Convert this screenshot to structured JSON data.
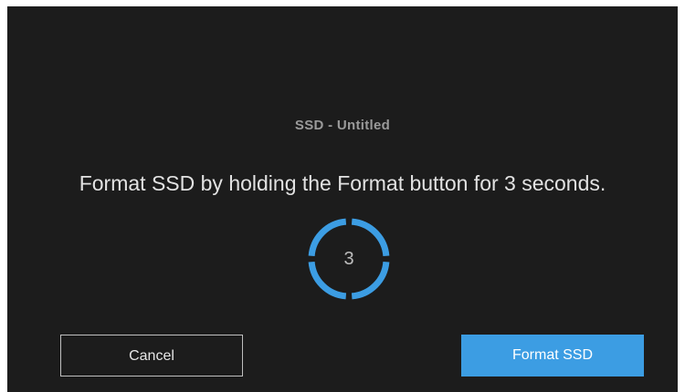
{
  "dialog": {
    "drive_name": "SSD - Untitled",
    "instruction": "Format SSD by holding the Format button for 3 seconds.",
    "countdown": {
      "value": "3",
      "progress_fraction": 1.0,
      "segments": 4,
      "ring_icon": "countdown-ring-icon",
      "color": "#3c9de3"
    },
    "cancel_label": "Cancel",
    "format_label": "Format SSD"
  },
  "colors": {
    "background": "#1c1c1c",
    "accent": "#3c9de3",
    "text": "#e2e2e2",
    "muted_text": "#9a9a9a"
  }
}
